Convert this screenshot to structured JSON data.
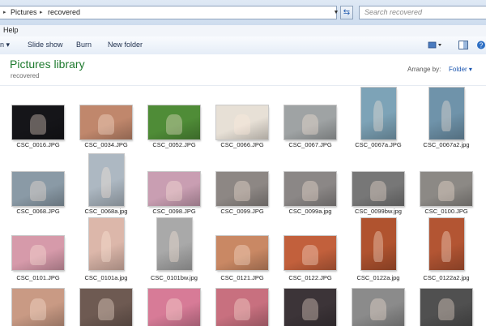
{
  "address": {
    "crumbs": [
      "Pictures",
      "recovered"
    ],
    "search_placeholder": "Search recovered"
  },
  "menu": {
    "help": "Help"
  },
  "toolbar": {
    "items": [
      "Slide show",
      "Burn",
      "New folder"
    ]
  },
  "library": {
    "title": "Pictures library",
    "subtitle": "recovered",
    "arrange_label": "Arrange by:",
    "arrange_value": "Folder"
  },
  "files": [
    {
      "name": "CSC_0016.JPG",
      "bg": "#151519"
    },
    {
      "name": "CSC_0034.JPG",
      "bg": "#c0876c"
    },
    {
      "name": "CSC_0052.JPG",
      "bg": "#4f8c37"
    },
    {
      "name": "CSC_0066.JPG",
      "bg": "#e7e0d6"
    },
    {
      "name": "CSC_0067.JPG",
      "bg": "#9fa3a4"
    },
    {
      "name": "CSC_0067a.JPG",
      "bg": "#7da3b7"
    },
    {
      "name": "CSC_0067a2.jpg",
      "bg": "#6f93aa"
    },
    {
      "name": "CSC_0068.JPG",
      "bg": "#8a9aa6"
    },
    {
      "name": "CSC_0068a.jpg",
      "bg": "#adb8c2"
    },
    {
      "name": "CSC_0098.JPG",
      "bg": "#c99eb2"
    },
    {
      "name": "CSC_0099.JPG",
      "bg": "#8d8784"
    },
    {
      "name": "CSC_0099a.jpg",
      "bg": "#8b8786"
    },
    {
      "name": "CSC_0099bw.jpg",
      "bg": "#777"
    },
    {
      "name": "CSC_0100.JPG",
      "bg": "#8c8985"
    },
    {
      "name": "CSC_0101.JPG",
      "bg": "#d69aaa"
    },
    {
      "name": "CSC_0101a.jpg",
      "bg": "#dcb7aa"
    },
    {
      "name": "CSC_0101bw.jpg",
      "bg": "#a9a9a9"
    },
    {
      "name": "CSC_0121.JPG",
      "bg": "#c98864"
    },
    {
      "name": "CSC_0122.JPG",
      "bg": "#c2603c"
    },
    {
      "name": "CSC_0122a.jpg",
      "bg": "#b0532f"
    },
    {
      "name": "CSC_0122a2.jpg",
      "bg": "#b35533"
    },
    {
      "name": "",
      "bg": "#c99a84"
    },
    {
      "name": "",
      "bg": "#6e5a52"
    },
    {
      "name": "",
      "bg": "#d77b97"
    },
    {
      "name": "",
      "bg": "#c8707f"
    },
    {
      "name": "",
      "bg": "#3c3438"
    },
    {
      "name": "",
      "bg": "#8b8b8b"
    },
    {
      "name": "",
      "bg": "#505050"
    }
  ]
}
